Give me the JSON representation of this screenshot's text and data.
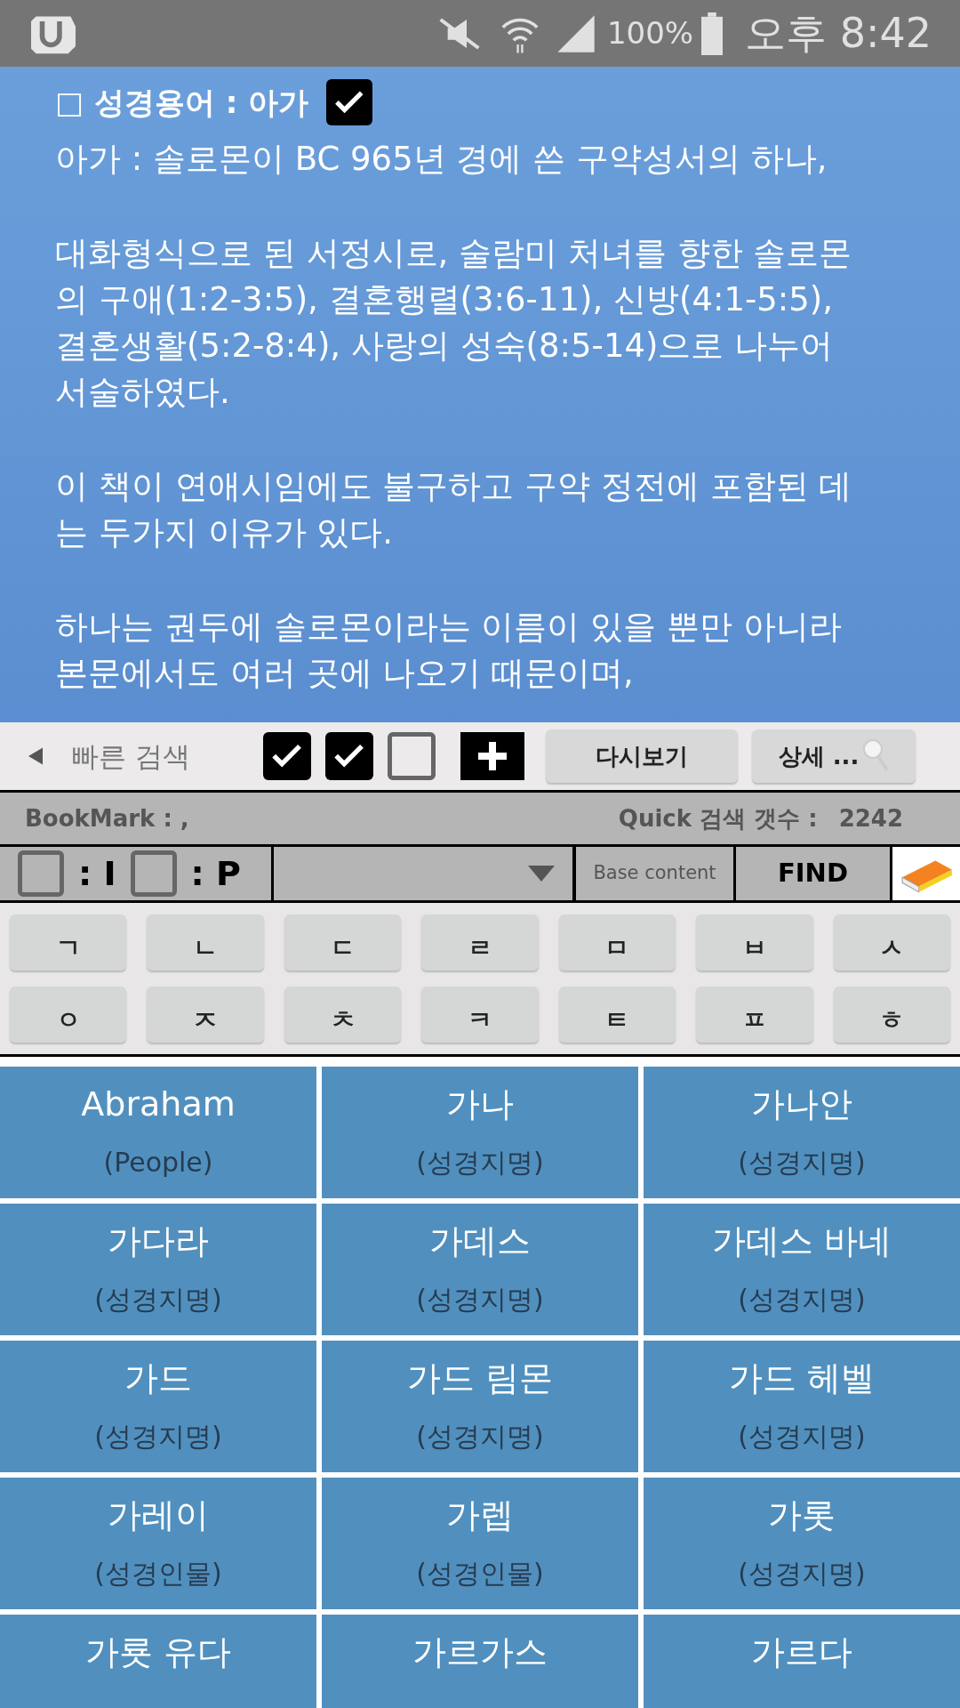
{
  "status_bar": {
    "battery": "100%",
    "time": "오후 8:42"
  },
  "article": {
    "title": "□ 성경용어 : 아가",
    "title_checked": true,
    "paragraphs": [
      "아가 : 솔로몬이 BC 965년 경에 쓴 구약성서의 하나,",
      "대화형식으로 된 서정시로, 술람미 처녀를 향한 솔로몬의 구애(1:2-3:5), 결혼행렬(3:6-11), 신방(4:1-5:5), 결혼생활(5:2-8:4), 사랑의 성숙(8:5-14)으로 나누어 서술하였다.",
      "이 책이 연애시임에도 불구하고 구약 정전에 포함된 데는 두가지 이유가 있다.",
      "하나는 권두에 솔로몬이라는 이름이 있을 뿐만 아니라 본문에서도 여러 곳에 나오기 때문이며,"
    ]
  },
  "toolbar": {
    "label": "빠른 검색",
    "checkboxes": [
      {
        "checked": true
      },
      {
        "checked": true
      },
      {
        "checked": false
      }
    ],
    "buttons": [
      "다시보기",
      "상세 ..."
    ]
  },
  "info_bar": {
    "bookmark": "BookMark : ,",
    "count_label": "Quick 검색 갯수 :",
    "count": "2242"
  },
  "search_row": {
    "options": [
      {
        "label": ": I",
        "checked": false
      },
      {
        "label": ": P",
        "checked": false
      }
    ],
    "placeholder": "Base content",
    "find": "FIND"
  },
  "consonants": [
    "ㄱ",
    "ㄴ",
    "ㄷ",
    "ㄹ",
    "ㅁ",
    "ㅂ",
    "ㅅ",
    "ㅇ",
    "ㅈ",
    "ㅊ",
    "ㅋ",
    "ㅌ",
    "ㅍ",
    "ㅎ"
  ],
  "entries": [
    {
      "title": "Abraham",
      "category": "(People)"
    },
    {
      "title": "가나",
      "category": "(성경지명)"
    },
    {
      "title": "가나안",
      "category": "(성경지명)"
    },
    {
      "title": "가다라",
      "category": "(성경지명)"
    },
    {
      "title": "가데스",
      "category": "(성경지명)"
    },
    {
      "title": "가데스 바네",
      "category": "(성경지명)"
    },
    {
      "title": "가드",
      "category": "(성경지명)"
    },
    {
      "title": "가드 림몬",
      "category": "(성경지명)"
    },
    {
      "title": "가드 헤벨",
      "category": "(성경지명)"
    },
    {
      "title": "가레이",
      "category": "(성경인물)"
    },
    {
      "title": "가렙",
      "category": "(성경인물)"
    },
    {
      "title": "가롯",
      "category": "(성경지명)"
    },
    {
      "title": "가룟 유다"
    },
    {
      "title": "가르가스"
    },
    {
      "title": "가르다"
    }
  ]
}
